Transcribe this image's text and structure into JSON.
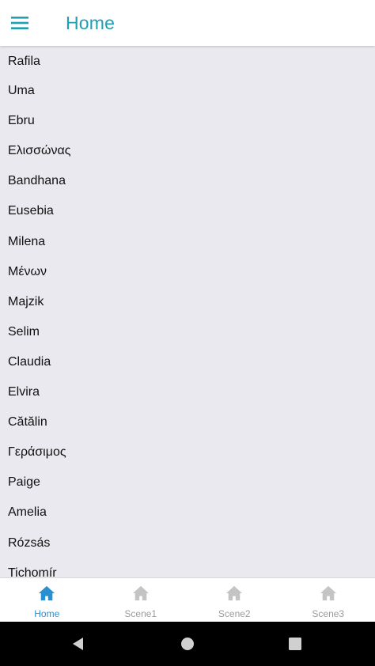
{
  "header": {
    "title": "Home",
    "menu_icon": "hamburger-menu-icon",
    "title_color": "#1e9fb2"
  },
  "list": {
    "items": [
      "Rafila",
      "Uma",
      "Ebru",
      "Ελισσώνας",
      "Bandhana",
      "Eusebia",
      "Milena",
      "Μένων",
      "Majzik",
      "Selim",
      "Claudia",
      "Elvira",
      "Cătălin",
      "Γεράσιμος",
      "Paige",
      "Amelia",
      "Rózsás",
      "Tichomír"
    ]
  },
  "tabs": {
    "items": [
      {
        "label": "Home",
        "icon": "home-icon",
        "active": true
      },
      {
        "label": "Scene1",
        "icon": "home-icon",
        "active": false
      },
      {
        "label": "Scene2",
        "icon": "home-icon",
        "active": false
      },
      {
        "label": "Scene3",
        "icon": "home-icon",
        "active": false
      }
    ],
    "active_color": "#2a8fd1",
    "inactive_color": "#c4c4c4"
  },
  "system_nav": {
    "buttons": [
      "back-icon",
      "home-circle-icon",
      "recents-icon"
    ]
  }
}
